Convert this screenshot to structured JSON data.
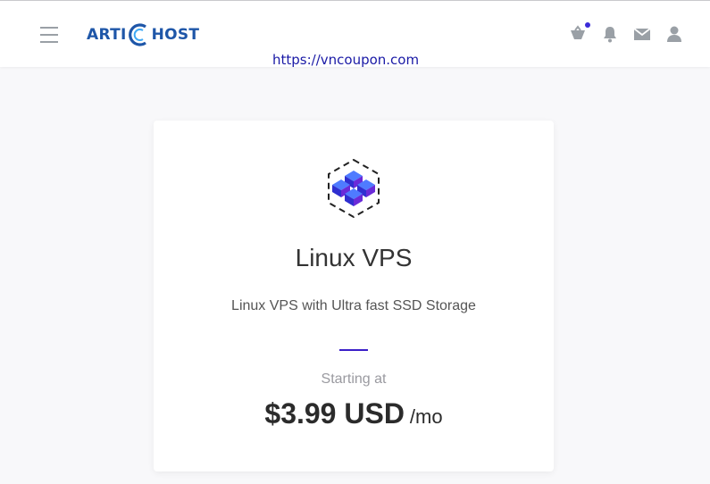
{
  "header": {
    "logo_text_left": "ARTI",
    "logo_text_right": "HOST",
    "watermark_url": "https://vncoupon.com",
    "icons": [
      "menu-icon",
      "cart-icon",
      "bell-icon",
      "mail-icon",
      "user-icon"
    ]
  },
  "plan": {
    "icon": "server-cubes-icon",
    "title": "Linux VPS",
    "description": "Linux VPS with Ultra fast SSD Storage",
    "starting_label": "Starting at",
    "price": "$3.99 USD",
    "period": "/mo"
  },
  "colors": {
    "brand": "#1e56a8",
    "accent": "#3b1fc8",
    "background": "#f8f8fa"
  }
}
